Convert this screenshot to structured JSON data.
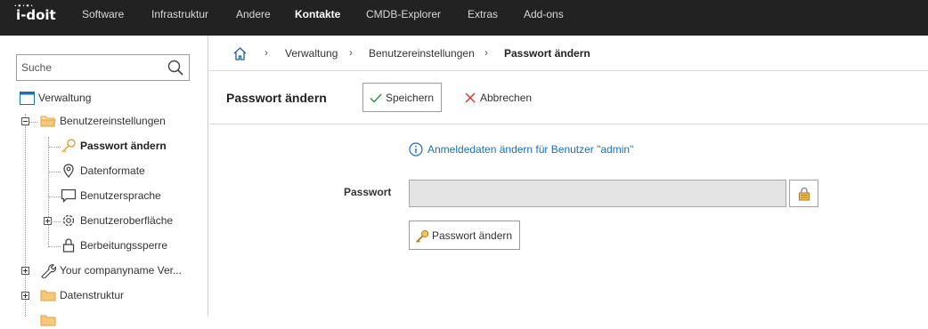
{
  "app": {
    "logo": "i-doit"
  },
  "nav": {
    "items": [
      "Software",
      "Infrastruktur",
      "Andere",
      "Kontakte",
      "CMDB-Explorer",
      "Extras",
      "Add-ons"
    ],
    "active": "Kontakte"
  },
  "search": {
    "placeholder": "Suche",
    "value": ""
  },
  "tree": {
    "root": "Verwaltung",
    "group": "Benutzereinstellungen",
    "items": [
      "Passwort ändern",
      "Datenformate",
      "Benutzersprache",
      "Benutzeroberfläche",
      "Berbeitungssperre"
    ],
    "current": "Passwort ändern",
    "company": "Your companyname Ver...",
    "datastruct": "Datenstruktur"
  },
  "breadcrumb": {
    "items": [
      "Verwaltung",
      "Benutzereinstellungen",
      "Passwort ändern"
    ]
  },
  "toolbar": {
    "title": "Passwort ändern",
    "save_label": "Speichern",
    "cancel_label": "Abbrechen"
  },
  "form": {
    "info": "Anmeldedaten ändern für Benutzer \"admin\"",
    "password_label": "Passwort",
    "password_value": "",
    "change_button": "Passwort ändern"
  },
  "colors": {
    "topbar": "#222222",
    "link": "#1a6fb5",
    "accent_key": "#e8a33c",
    "folder": "#f5c36b"
  }
}
